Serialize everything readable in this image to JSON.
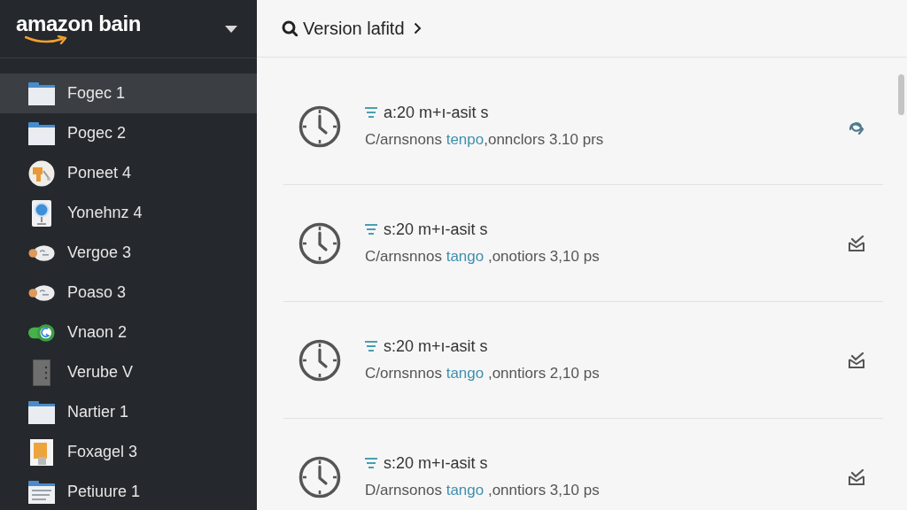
{
  "sidebar": {
    "brand": "amazon bain",
    "items": [
      {
        "label": "Fogec 1",
        "kind": "folder",
        "selected": true
      },
      {
        "label": "Pogec 2",
        "kind": "folder",
        "selected": false
      },
      {
        "label": "Poneet 4",
        "kind": "disc",
        "selected": false
      },
      {
        "label": "Yonehnz 4",
        "kind": "device",
        "selected": false
      },
      {
        "label": "Vergoe 3",
        "kind": "cloud",
        "selected": false
      },
      {
        "label": "Poaso 3",
        "kind": "cloud",
        "selected": false
      },
      {
        "label": "Vnaon 2",
        "kind": "toggle",
        "selected": false
      },
      {
        "label": "Verube V",
        "kind": "cabinet",
        "selected": false
      },
      {
        "label": "Nartier 1",
        "kind": "folder",
        "selected": false
      },
      {
        "label": "Foxagel 3",
        "kind": "document",
        "selected": false
      },
      {
        "label": "Petiuure 1",
        "kind": "docfolder",
        "selected": false
      }
    ]
  },
  "header": {
    "title": "Version lafitd"
  },
  "versions": [
    {
      "title": "a:20 m+ı-asit s",
      "details": {
        "prefix": "C/arnsnons",
        "link": "tenpo",
        "suffix": ",onnclors 3.10 prs"
      },
      "action": {
        "kind": "swirl"
      }
    },
    {
      "title": "s:20 m+ı-asit s",
      "details": {
        "prefix": "C/arnsnnos",
        "link": "tango",
        "suffix": " ,onotiors 3,10 ps"
      },
      "action": {
        "kind": "tray"
      }
    },
    {
      "title": "s:20 m+ı-asit s",
      "details": {
        "prefix": "C/ornsnnos",
        "link": "tango",
        "suffix": " ,onntiors 2,10 ps"
      },
      "action": {
        "kind": "tray"
      }
    },
    {
      "title": "s:20 m+ı-asit s",
      "details": {
        "prefix": "D/arnsonos",
        "link": "tango",
        "suffix": " ,onntiors 3,10 ps"
      },
      "action": {
        "kind": "tray"
      }
    }
  ]
}
